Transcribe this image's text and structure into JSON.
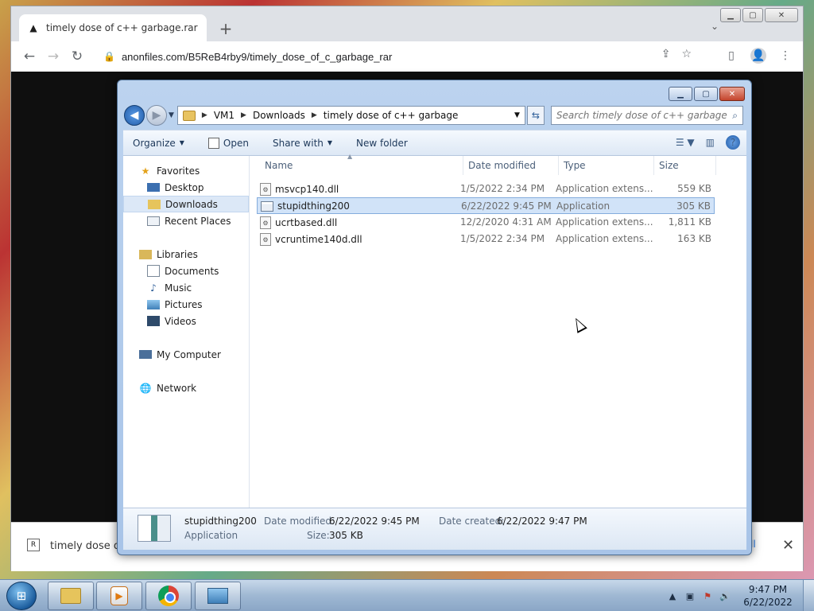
{
  "browser": {
    "tab_title": "timely dose of c++ garbage.rar -",
    "new_tab_glyph": "+",
    "url": "anonfiles.com/B5ReB4rby9/timely_dose_of_c_garbage_rar",
    "download_item": "timely dose of",
    "download_show_all": "ll"
  },
  "explorer": {
    "breadcrumb": [
      "VM1",
      "Downloads",
      "timely dose of c++ garbage"
    ],
    "search_placeholder": "Search timely dose of c++ garbage",
    "commands": {
      "organize": "Organize",
      "open": "Open",
      "share_with": "Share with",
      "new_folder": "New folder"
    },
    "nav": {
      "favorites": "Favorites",
      "desktop": "Desktop",
      "downloads": "Downloads",
      "recent_places": "Recent Places",
      "libraries": "Libraries",
      "documents": "Documents",
      "music": "Music",
      "pictures": "Pictures",
      "videos": "Videos",
      "my_computer": "My Computer",
      "network": "Network"
    },
    "columns": {
      "name": "Name",
      "date_modified": "Date modified",
      "type": "Type",
      "size": "Size"
    },
    "files": [
      {
        "name": "msvcp140.dll",
        "date": "1/5/2022 2:34 PM",
        "type": "Application extens...",
        "size": "559 KB"
      },
      {
        "name": "stupidthing200",
        "date": "6/22/2022 9:45 PM",
        "type": "Application",
        "size": "305 KB"
      },
      {
        "name": "ucrtbased.dll",
        "date": "12/2/2020 4:31 AM",
        "type": "Application extens...",
        "size": "1,811 KB"
      },
      {
        "name": "vcruntime140d.dll",
        "date": "1/5/2022 2:34 PM",
        "type": "Application extens...",
        "size": "163 KB"
      }
    ],
    "details": {
      "name": "stupidthing200",
      "type": "Application",
      "date_modified_label": "Date modified:",
      "date_modified": "6/22/2022 9:45 PM",
      "size_label": "Size:",
      "size": "305 KB",
      "date_created_label": "Date created:",
      "date_created": "6/22/2022 9:47 PM"
    }
  },
  "taskbar": {
    "time": "9:47 PM",
    "date": "6/22/2022"
  }
}
